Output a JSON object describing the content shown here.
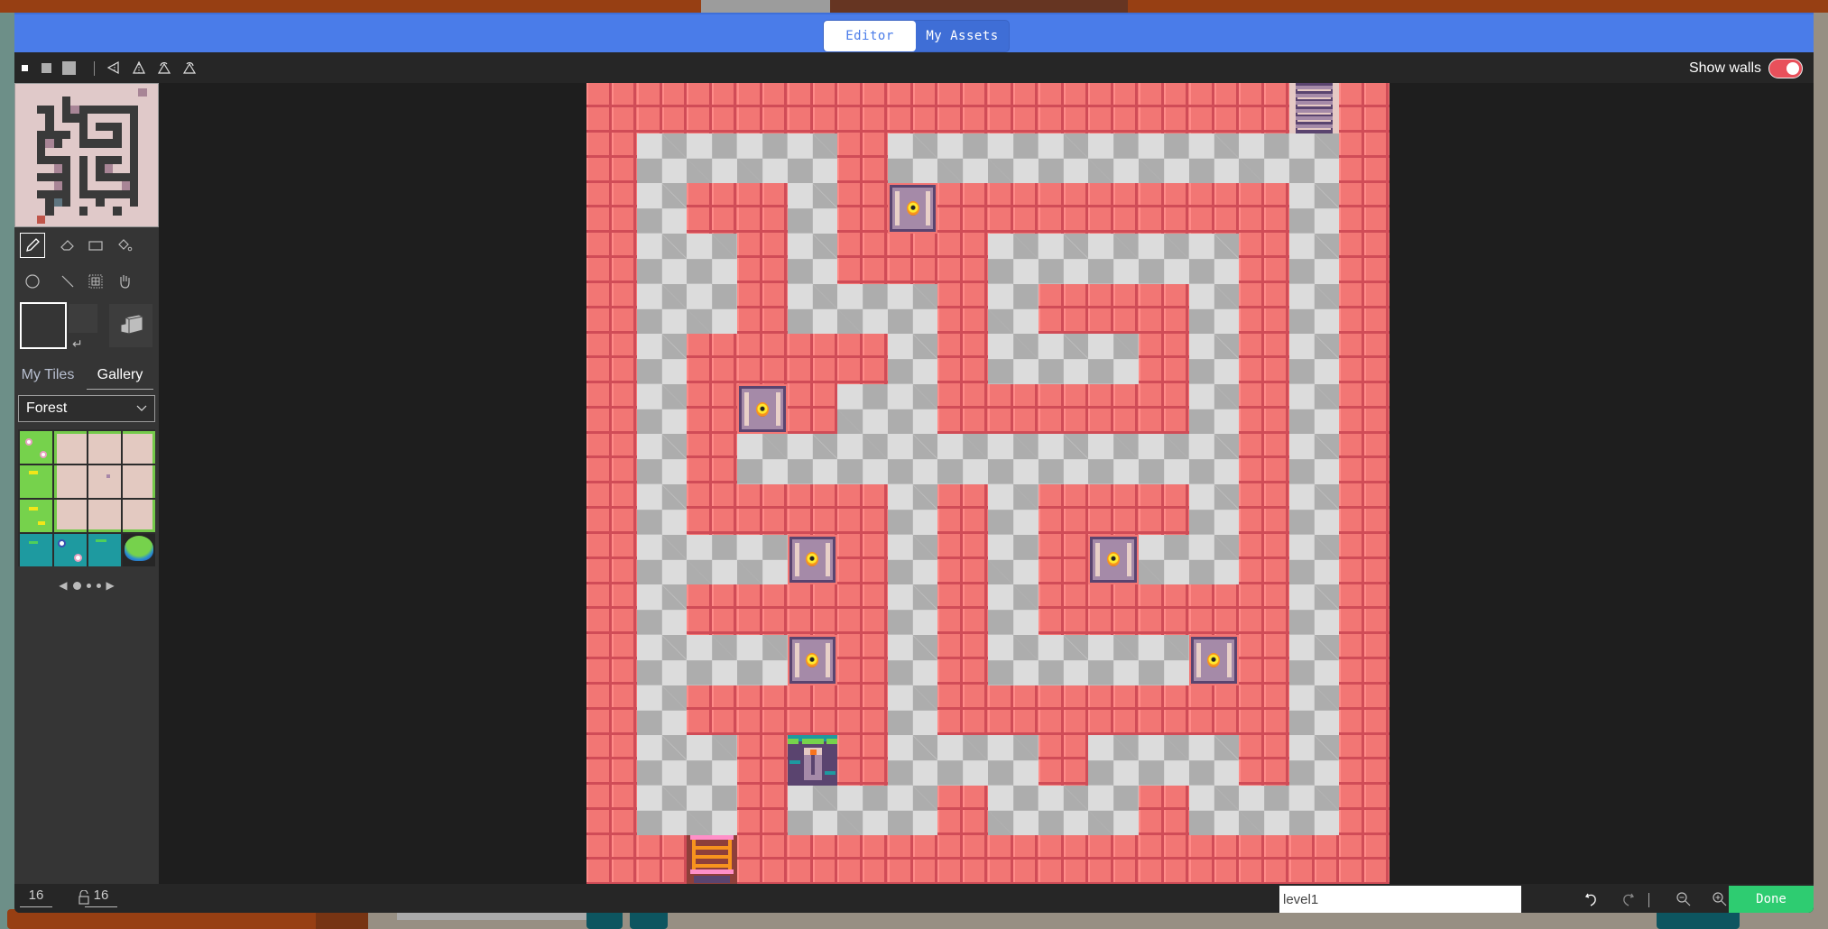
{
  "header": {
    "tabs": [
      {
        "label": "Editor",
        "active": true
      },
      {
        "label": "My Assets",
        "active": false
      }
    ]
  },
  "toolbar": {
    "brush_sizes": [
      "small-brush",
      "medium-brush",
      "large-brush"
    ],
    "transform_icons": [
      "flip-horizontal-icon",
      "flip-vertical-icon",
      "rotate-ccw-icon",
      "rotate-cw-icon"
    ],
    "show_walls_label": "Show walls",
    "show_walls_on": true
  },
  "sidebar": {
    "tools": [
      "pencil",
      "eraser",
      "rectangle",
      "fill",
      "circle",
      "line",
      "select",
      "hand"
    ],
    "selected_tool": "pencil",
    "tabs": [
      {
        "label": "My Tiles",
        "active": false
      },
      {
        "label": "Gallery",
        "active": true
      }
    ],
    "tileset": "Forest",
    "pager": {
      "pages": 3,
      "current": 1
    }
  },
  "map": {
    "width": 16,
    "height": 16,
    "legend": {
      "W": "wall",
      ".": "floor",
      "C": "chest",
      "U": "stairs-up",
      "D": "door",
      "L": "ladder-down"
    },
    "rows": [
      "WWWWWWWWWWWWWWUW",
      "W....W.........W",
      "W.WW.WCWWWWWWW.W",
      "W..W.WWW.....W.W",
      "W..W...W.WWW.W.W",
      "W.WWWW.W...W.W.W",
      "W.WCW..WWWWW.W.W",
      "W.W..........W.W",
      "W.WWWW.W.WWW.W.W",
      "W...CW.W.WC..W.W",
      "W.WWWW.W.WWWWW.W",
      "W...CW.W....CW.W",
      "W.WWWW.WWWWWWW.W",
      "W..WDW...W...W.W",
      "W..W...W...W...W",
      "WWLWWWWWWWWWWWWW"
    ]
  },
  "bottombar": {
    "width_value": "16",
    "height_value": "16",
    "level_name": "level1",
    "done_label": "Done"
  }
}
